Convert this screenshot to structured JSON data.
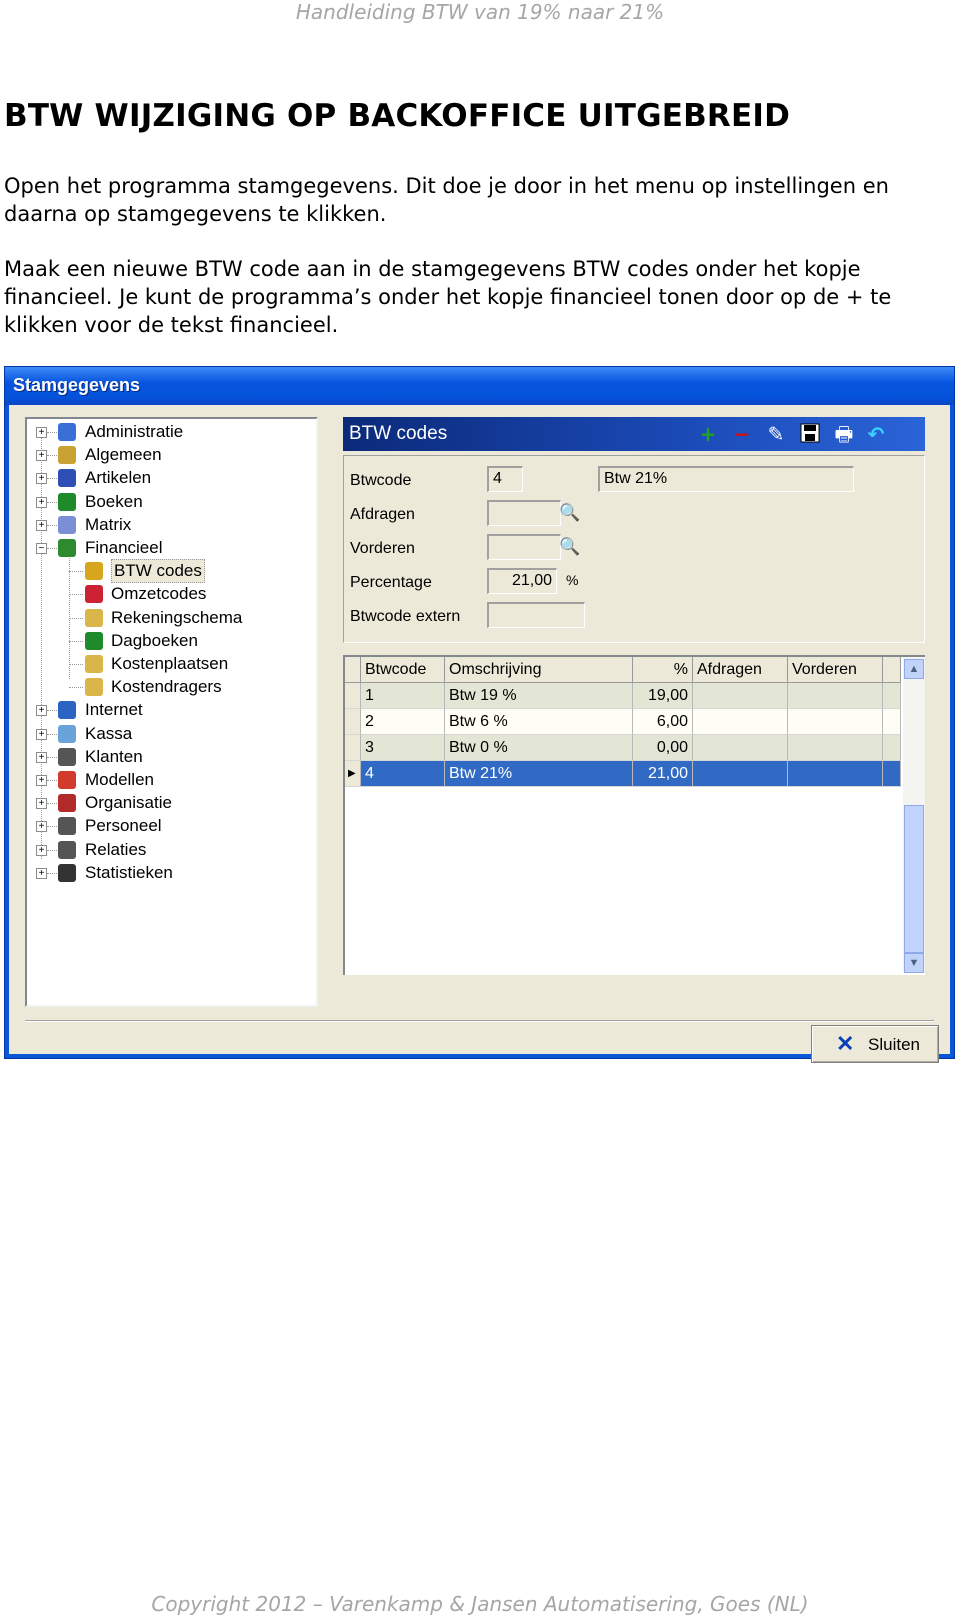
{
  "document": {
    "header": "Handleiding BTW van 19% naar 21%",
    "title": "BTW WIJZIGING OP BACKOFFICE UITGEBREID",
    "paragraph1": "Open het programma stamgegevens. Dit doe je door in het menu op instellingen en daarna op stamgegevens te klikken.",
    "paragraph2": "Maak een nieuwe BTW code aan in de stamgegevens BTW codes onder het kopje financieel. Je kunt de programma’s onder het kopje financieel tonen door op de + te klikken voor de tekst financieel.",
    "footer": "Copyright 2012 – Varenkamp & Jansen Automatisering, Goes (NL)"
  },
  "window": {
    "title": "Stamgegevens"
  },
  "tree": {
    "items": [
      {
        "label": "Administratie",
        "icon": "computer-icon",
        "expander": "+"
      },
      {
        "label": "Algemeen",
        "icon": "settings-icon",
        "expander": "+"
      },
      {
        "label": "Artikelen",
        "icon": "grid-icon",
        "expander": "+"
      },
      {
        "label": "Boeken",
        "icon": "book-icon",
        "expander": "+"
      },
      {
        "label": "Matrix",
        "icon": "matrix-icon",
        "expander": "+"
      },
      {
        "label": "Financieel",
        "icon": "money-icon",
        "expander": "−"
      },
      {
        "label": "Internet",
        "icon": "globe-icon",
        "expander": "+"
      },
      {
        "label": "Kassa",
        "icon": "cash-register-icon",
        "expander": "+"
      },
      {
        "label": "Klanten",
        "icon": "customers-icon",
        "expander": "+"
      },
      {
        "label": "Modellen",
        "icon": "models-icon",
        "expander": "+"
      },
      {
        "label": "Organisatie",
        "icon": "house-icon",
        "expander": "+"
      },
      {
        "label": "Personeel",
        "icon": "people-icon",
        "expander": "+"
      },
      {
        "label": "Relaties",
        "icon": "relations-icon",
        "expander": "+"
      },
      {
        "label": "Statistieken",
        "icon": "statistics-icon",
        "expander": "+"
      }
    ],
    "children": [
      {
        "label": "BTW codes",
        "icon": "coins-icon",
        "selected": true
      },
      {
        "label": "Omzetcodes",
        "icon": "chart-icon"
      },
      {
        "label": "Rekeningschema",
        "icon": "tree-icon"
      },
      {
        "label": "Dagboeken",
        "icon": "book-icon"
      },
      {
        "label": "Kostenplaatsen",
        "icon": "tree-icon"
      },
      {
        "label": "Kostendragers",
        "icon": "tree-icon"
      }
    ]
  },
  "panel": {
    "title": "BTW codes",
    "toolbar": [
      "add-icon",
      "delete-icon",
      "edit-icon",
      "save-icon",
      "print-icon",
      "undo-icon"
    ]
  },
  "form": {
    "btwcode_label": "Btwcode",
    "btwcode_value": "4",
    "description_value": "Btw 21%",
    "afdragen_label": "Afdragen",
    "afdragen_value": "",
    "vorderen_label": "Vorderen",
    "vorderen_value": "",
    "percentage_label": "Percentage",
    "percentage_value": "21,00",
    "percent_sign": "%",
    "extern_label": "Btwcode extern",
    "extern_value": ""
  },
  "grid": {
    "columns": [
      "Btwcode",
      "Omschrijving",
      "%",
      "Afdragen",
      "Vorderen"
    ],
    "rows": [
      [
        "1",
        "Btw 19 %",
        "19,00",
        "",
        ""
      ],
      [
        "2",
        "Btw 6 %",
        "6,00",
        "",
        ""
      ],
      [
        "3",
        "Btw 0 %",
        "0,00",
        "",
        ""
      ],
      [
        "4",
        "Btw 21%",
        "21,00",
        "",
        ""
      ]
    ],
    "selected_row": 3
  },
  "buttons": {
    "close": "Sluiten"
  },
  "colors": {
    "titlebar": "#0a56d6",
    "selection": "#316ac5",
    "panel_header": "#0b2a7a"
  }
}
